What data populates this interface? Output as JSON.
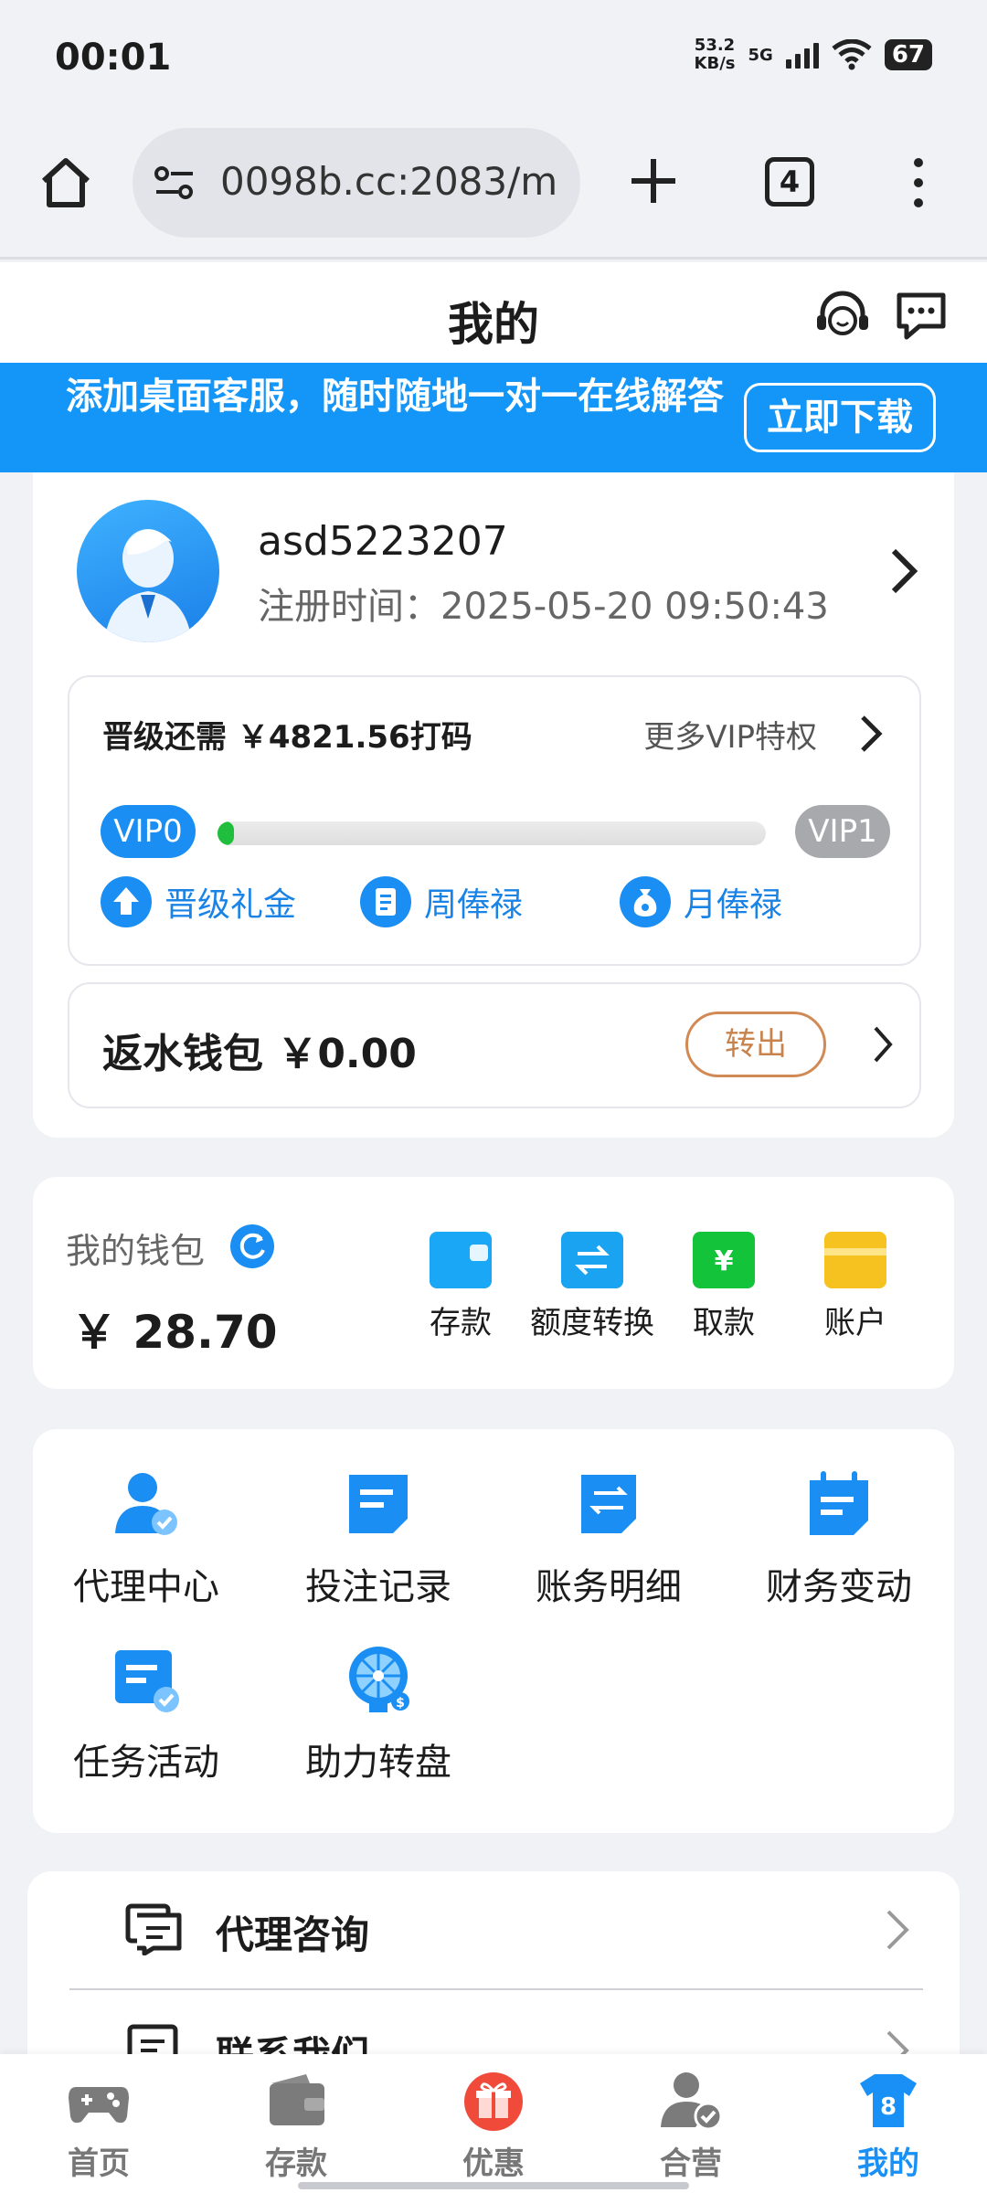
{
  "status_bar": {
    "time": "00:01",
    "net_speed_top": "53.2",
    "net_speed_bottom": "KB/s",
    "network": "5G",
    "battery": "67"
  },
  "browser": {
    "url": "0098b.cc:2083/m",
    "tab_count": "4"
  },
  "header": {
    "title": "我的"
  },
  "banner": {
    "text": "添加桌面客服，随时随地一对一在线解答",
    "button": "立即下载"
  },
  "profile": {
    "username": "asd5223207",
    "reg_time": "注册时间：2025-05-20 09:50:43"
  },
  "vip": {
    "need_text": "晋级还需 ￥4821.56打码",
    "more_text": "更多VIP特权",
    "current": "VIP0",
    "next": "VIP1",
    "progress": 0.03,
    "perks": [
      "晋级礼金",
      "周俸禄",
      "月俸禄"
    ]
  },
  "rebate": {
    "label": "返水钱包 ￥0.00",
    "button": "转出"
  },
  "wallet": {
    "label": "我的钱包",
    "amount": "￥ 28.70",
    "actions": [
      "存款",
      "额度转换",
      "取款",
      "账户"
    ]
  },
  "menu_grid": [
    "代理中心",
    "投注记录",
    "账务明细",
    "财务变动",
    "任务活动",
    "助力转盘"
  ],
  "list": [
    "代理咨询",
    "联系我们"
  ],
  "bottom_nav": [
    "首页",
    "存款",
    "优惠",
    "合营",
    "我的"
  ],
  "colors": {
    "primary": "#1396f7",
    "progress": "#1fbf3d",
    "rebate_button": "#c8824b",
    "promo_red": "#f04a3a"
  }
}
